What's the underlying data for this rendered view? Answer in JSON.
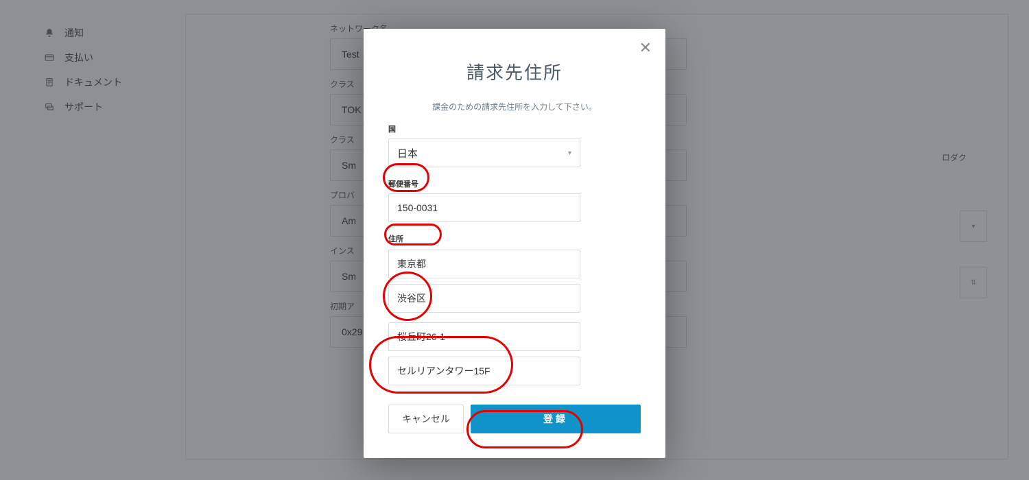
{
  "sidebar": {
    "items": [
      {
        "label": "通知",
        "icon": "bell"
      },
      {
        "label": "支払い",
        "icon": "card"
      },
      {
        "label": "ドキュメント",
        "icon": "doc"
      },
      {
        "label": "サポート",
        "icon": "chat"
      }
    ]
  },
  "form": {
    "network_label": "ネットワーク名",
    "network_value": "Test",
    "cluster_label1": "クラス",
    "cluster_value1": "TOK",
    "cluster_label2": "クラス",
    "cluster_value2": "Sm",
    "provider_label": "プロバ",
    "provider_value": "Am",
    "instance_label": "インス",
    "instance_value": "Sm",
    "addr_label": "初期ア",
    "addr_value": "0x29",
    "side_text": "ロダク"
  },
  "modal": {
    "title": "請求先住所",
    "subtitle": "課金のための請求先住所を入力して下さい。",
    "country_label": "国",
    "country_value": "日本",
    "postal_label": "郵便番号",
    "postal_value": "150-0031",
    "address_label": "住所",
    "prefecture_value": "東京都",
    "city_value": "渋谷区",
    "line1_value": "桜丘町26-1",
    "line2_value": "セルリアンタワー15F",
    "cancel_label": "キャンセル",
    "submit_label": "登録"
  }
}
